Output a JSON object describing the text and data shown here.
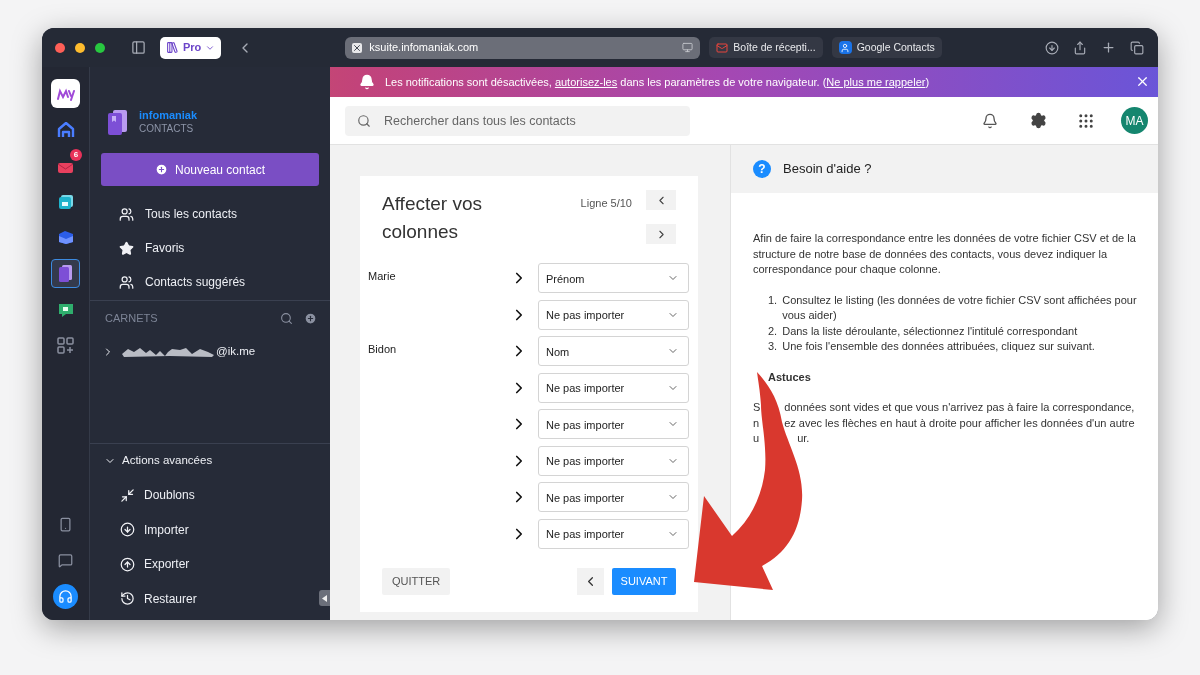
{
  "browser": {
    "profile": "Pro",
    "url": "ksuite.infomaniak.com",
    "tabs": [
      {
        "title": "Boîte de récepti...",
        "kind": "mail"
      },
      {
        "title": "Google Contacts",
        "kind": "contacts"
      }
    ]
  },
  "banner": {
    "before": "Les notifications sont désactivées, ",
    "link": "autorisez-les",
    "middle": " dans les paramètres de votre navigateur. (",
    "link2": "Ne plus me rappeler",
    "after": ")"
  },
  "rail": {
    "apps": [
      {
        "kind": "my",
        "selected": false
      },
      {
        "kind": "home",
        "selected": false
      },
      {
        "kind": "mail",
        "selected": false,
        "badge": "6"
      },
      {
        "kind": "calendar",
        "selected": false
      },
      {
        "kind": "drive",
        "selected": false
      },
      {
        "kind": "contacts",
        "selected": true
      },
      {
        "kind": "meet",
        "selected": false
      },
      {
        "kind": "add-apps",
        "selected": false
      }
    ],
    "bottom": [
      {
        "kind": "phone"
      },
      {
        "kind": "chat"
      },
      {
        "kind": "support"
      }
    ]
  },
  "sidebar": {
    "brand": "infomaniak",
    "product": "CONTACTS",
    "new_button": "Nouveau contact",
    "nav": [
      {
        "label": "Tous les contacts",
        "kind": "all"
      },
      {
        "label": "Favoris",
        "kind": "favorites"
      },
      {
        "label": "Contacts suggérés",
        "kind": "suggested"
      }
    ],
    "section_title": "CARNETS",
    "address_books": [
      {
        "label": "@ik.me",
        "expanded": false
      }
    ],
    "advanced": {
      "title": "Actions avancées",
      "expanded": true,
      "items": [
        {
          "label": "Doublons",
          "kind": "duplicates"
        },
        {
          "label": "Importer",
          "kind": "import"
        },
        {
          "label": "Exporter",
          "kind": "export"
        },
        {
          "label": "Restaurer",
          "kind": "restore"
        }
      ]
    }
  },
  "header": {
    "search_placeholder": "Rechercher dans tous les contacts",
    "avatar": "MA"
  },
  "mapping": {
    "title": "Affecter vos colonnes",
    "line": "Ligne 5/10",
    "rows": [
      {
        "source": "Marie",
        "target": "Prénom"
      },
      {
        "target": "Ne pas importer"
      },
      {
        "source": "Bidon",
        "target": "Nom"
      },
      {
        "target": "Ne pas importer"
      },
      {
        "target": "Ne pas importer"
      },
      {
        "target": "Ne pas importer"
      },
      {
        "target": "Ne pas importer"
      },
      {
        "target": "Ne pas importer"
      }
    ],
    "quit": "QUITTER",
    "next": "SUIVANT"
  },
  "help": {
    "title": "Besoin d'aide ?",
    "intro": "Afin de faire la correspondance entre les données de votre fichier CSV et de la structure de notre base de données des contacts, vous devez indiquer la correspondance pour chaque colonne.",
    "help_icon": "?",
    "steps": [
      {
        "number": "1.",
        "text": "Consultez le listing (les données de votre fichier CSV sont affichées pour vous aider)"
      },
      {
        "number": "2.",
        "text": "Dans la liste déroulante, sélectionnez l'intitulé correspondant"
      },
      {
        "number": "3.",
        "text": "Une fois l'ensemble des données attribuées, cliquez sur suivant."
      }
    ],
    "tips_title": "Astuces",
    "tips_lines": [
      [
        "S",
        "données sont vides et que vous n'arrivez pas à faire la correspondance,"
      ],
      [
        "n",
        "ez avec les flèches en haut à droite pour afficher les données d'un autre"
      ],
      [
        "u",
        "ur."
      ]
    ]
  }
}
